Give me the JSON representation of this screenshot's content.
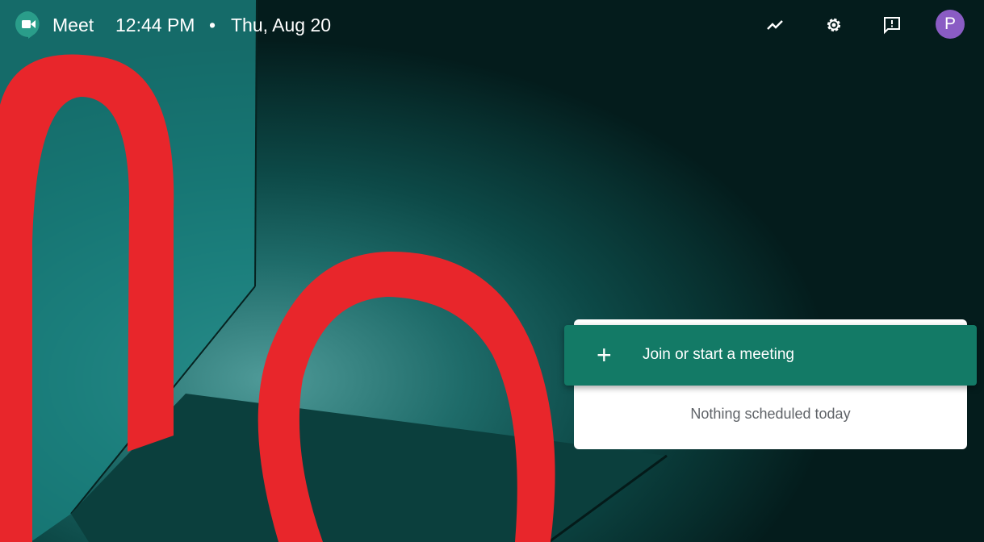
{
  "header": {
    "app_name": "Meet",
    "time": "12:44 PM",
    "separator": "•",
    "date": "Thu, Aug 20",
    "avatar_letter": "P"
  },
  "icons": [
    "meet-logo-icon",
    "activity-chart-icon",
    "settings-gear-icon",
    "feedback-icon"
  ],
  "card": {
    "join_label": "Join or start a meeting",
    "plus": "+",
    "empty_message": "Nothing scheduled today"
  },
  "colors": {
    "accent": "#137a66",
    "avatar": "#8a5cc4"
  }
}
